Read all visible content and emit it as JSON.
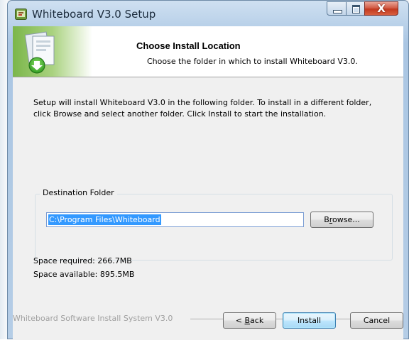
{
  "window": {
    "title": "Whiteboard V3.0 Setup",
    "close_glyph": "X"
  },
  "header": {
    "title": "Choose Install Location",
    "subtitle": "Choose the folder in which to install Whiteboard V3.0."
  },
  "intro": {
    "line1": "Setup will install Whiteboard V3.0 in the following folder. To install in a different folder,",
    "line2": "click Browse and select another folder. Click Install to start the installation."
  },
  "destination": {
    "label": "Destination Folder",
    "path": "C:\\Program Files\\Whiteboard",
    "browse_pre": "B",
    "browse_key": "r",
    "browse_post": "owse..."
  },
  "space": {
    "required": "Space required: 266.7MB",
    "available": "Space available: 895.5MB"
  },
  "branding": "Whiteboard Software Install System V3.0",
  "buttons": {
    "back_pre": "< ",
    "back_key": "B",
    "back_post": "ack",
    "install": "Install",
    "cancel": "Cancel"
  },
  "icons": {
    "app": "installer-app-icon",
    "header": "install-package-download-icon",
    "minimize": "minimize-icon",
    "maximize": "maximize-icon",
    "close": "close-icon"
  },
  "colors": {
    "selection": "#3399ff",
    "close_button": "#c2391f",
    "default_button_border": "#3c7fb1"
  }
}
